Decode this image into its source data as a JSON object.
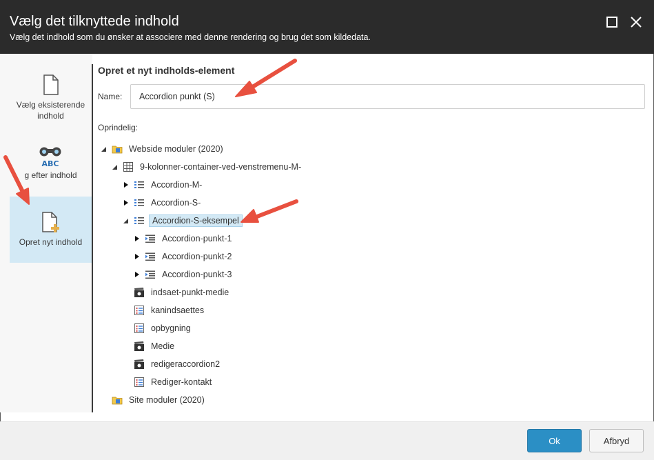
{
  "dialog": {
    "title": "Vælg det tilknyttede indhold",
    "subtitle": "Vælg det indhold som du ønsker at associere med denne rendering og brug det som kildedata."
  },
  "sidebar": {
    "items": [
      {
        "label_line1": "Vælg eksisterende",
        "label_line2": "indhold",
        "icon": "document-icon"
      },
      {
        "label_line1": "",
        "label_line2": "g efter indhold",
        "icon": "binoculars-abc-icon"
      },
      {
        "label_line1": "Opret nyt indhold",
        "label_line2": "",
        "icon": "new-document-icon",
        "active": true
      }
    ]
  },
  "main": {
    "section_title": "Opret et nyt indholds-element",
    "name_label": "Name:",
    "name_value": "Accordion punkt (S)",
    "origin_label": "Oprindelig:"
  },
  "tree": [
    {
      "label": "Webside moduler (2020)",
      "toggle": "open",
      "icon": "folder-icon"
    },
    {
      "label": "9-kolonner-container-ved-venstremenu-M-",
      "toggle": "open",
      "icon": "grid-icon"
    },
    {
      "label": "Accordion-M-",
      "toggle": "closed",
      "icon": "list-icon"
    },
    {
      "label": "Accordion-S-",
      "toggle": "closed",
      "icon": "list-icon"
    },
    {
      "label": "Accordion-S-eksempel",
      "toggle": "open",
      "icon": "list-icon",
      "selected": true
    },
    {
      "label": "Accordion-punkt-1",
      "toggle": "closed",
      "icon": "indent-list-icon"
    },
    {
      "label": "Accordion-punkt-2",
      "toggle": "closed",
      "icon": "indent-list-icon"
    },
    {
      "label": "Accordion-punkt-3",
      "toggle": "closed",
      "icon": "indent-list-icon"
    },
    {
      "label": "indsaet-punkt-medie",
      "toggle": "none",
      "icon": "clapper-icon"
    },
    {
      "label": "kanindsaettes",
      "toggle": "none",
      "icon": "form-icon"
    },
    {
      "label": "opbygning",
      "toggle": "none",
      "icon": "form-icon"
    },
    {
      "label": "Medie",
      "toggle": "none",
      "icon": "clapper-icon"
    },
    {
      "label": "redigeraccordion2",
      "toggle": "none",
      "icon": "clapper-icon"
    },
    {
      "label": "Rediger-kontakt",
      "toggle": "none",
      "icon": "form-icon"
    },
    {
      "label": "Site moduler (2020)",
      "toggle": "none",
      "icon": "folder-icon"
    }
  ],
  "footer": {
    "ok_label": "Ok",
    "cancel_label": "Afbryd"
  },
  "colors": {
    "header_bg": "#2b2b2b",
    "selection_bg": "#d3e9f5",
    "primary_button": "#2b8fc5",
    "annotation_arrow": "#e8503f"
  }
}
